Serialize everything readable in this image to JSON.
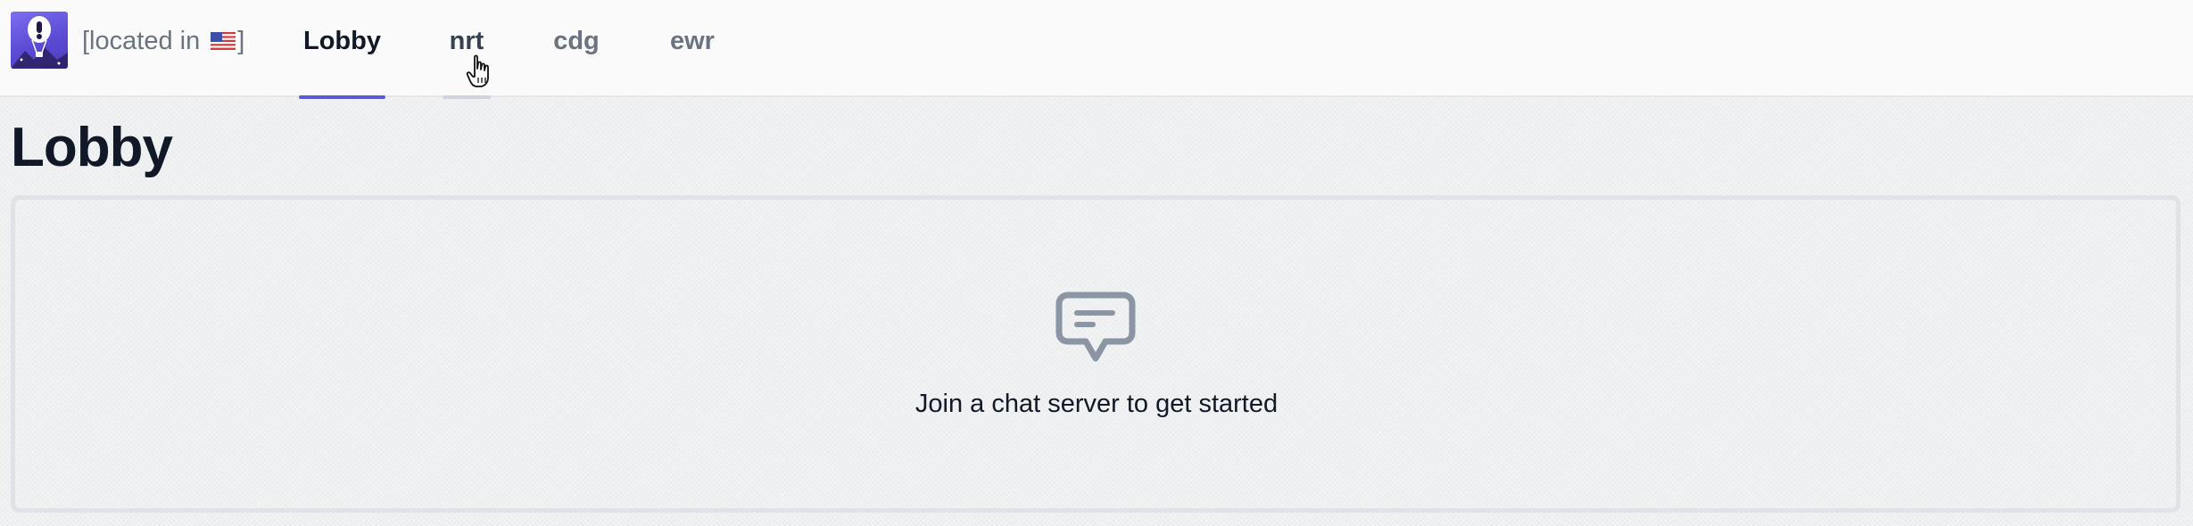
{
  "header": {
    "location_prefix": "[located in",
    "location_suffix": "]",
    "location_flag_icon": "us-flag-icon",
    "tabs": [
      {
        "label": "Lobby",
        "active": true
      },
      {
        "label": "nrt",
        "hovered": true
      },
      {
        "label": "cdg"
      },
      {
        "label": "ewr"
      }
    ]
  },
  "main": {
    "title": "Lobby",
    "empty_state": {
      "icon": "chat-bubble-icon",
      "message": "Join a chat server to get started"
    }
  },
  "colors": {
    "accent": "#5b5bd6",
    "hover_underline": "#d1d5db",
    "muted_text": "#6b7280",
    "primary_text": "#111827",
    "icon": "#8b95a3"
  }
}
